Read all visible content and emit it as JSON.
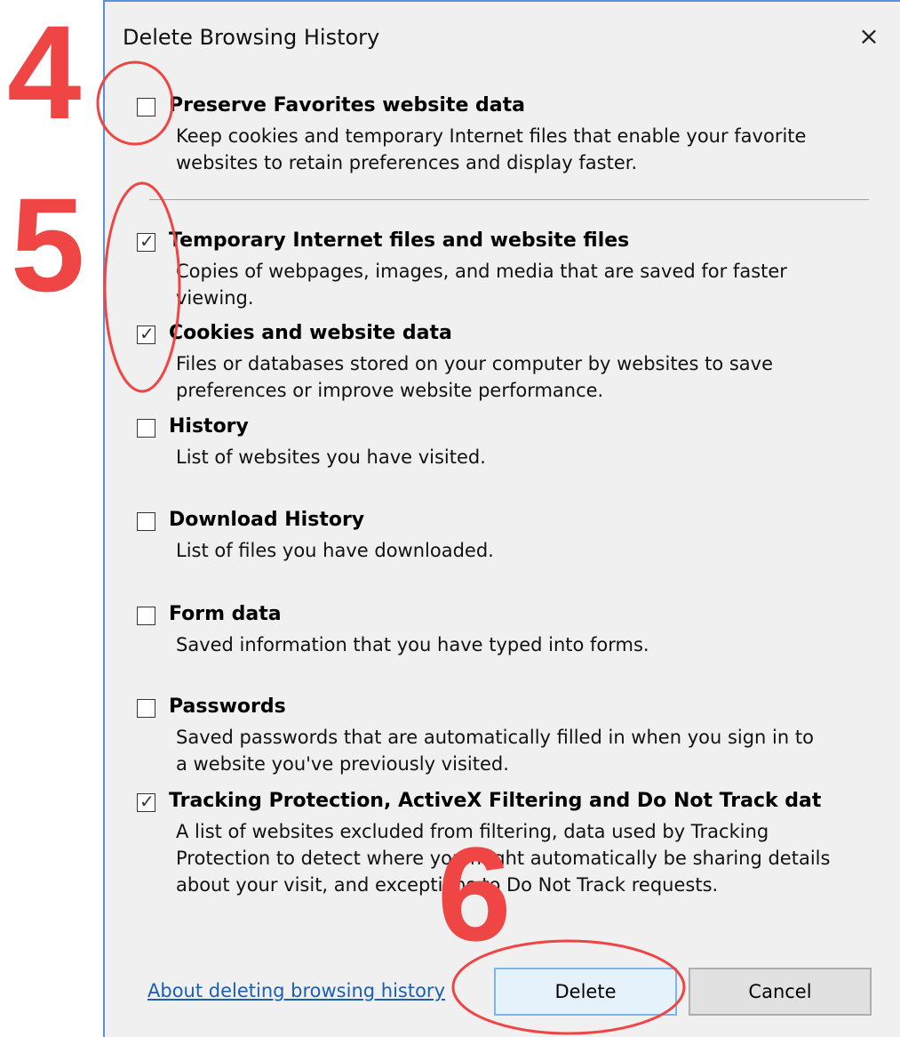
{
  "dialog": {
    "title": "Delete Browsing History",
    "close_icon": "×"
  },
  "items": [
    {
      "label": "Preserve Favorites website data",
      "checked": false,
      "desc": [
        "Keep cookies and temporary Internet files that enable your favorite",
        "websites to retain preferences and display faster."
      ]
    },
    {
      "label": "Temporary Internet files and website files",
      "checked": true,
      "desc": [
        "Copies of webpages, images, and media that are saved for faster",
        "viewing."
      ]
    },
    {
      "label": "Cookies and website data",
      "checked": true,
      "desc": [
        "Files or databases stored on your computer by websites to save",
        "preferences or improve website performance."
      ]
    },
    {
      "label": "History",
      "checked": false,
      "desc": [
        "List of websites you have visited."
      ]
    },
    {
      "label": "Download History",
      "checked": false,
      "desc": [
        "List of files you have downloaded."
      ]
    },
    {
      "label": "Form data",
      "checked": false,
      "desc": [
        "Saved information that you have typed into forms."
      ]
    },
    {
      "label": "Passwords",
      "checked": false,
      "desc": [
        "Saved passwords that are automatically filled in when you sign in to",
        "a website you've previously visited."
      ]
    },
    {
      "label": "Tracking Protection, ActiveX Filtering and Do Not Track dat",
      "checked": true,
      "desc": [
        "A list of websites excluded from filtering, data used by Tracking",
        "Protection to detect where you might automatically be sharing details",
        "about your visit, and exceptions to Do Not Track requests."
      ]
    }
  ],
  "footer": {
    "link": "About deleting browsing history",
    "delete_label": "Delete",
    "cancel_label": "Cancel"
  },
  "annotations": {
    "step4": "4",
    "step5": "5",
    "step6": "6",
    "color": "#f04545"
  }
}
